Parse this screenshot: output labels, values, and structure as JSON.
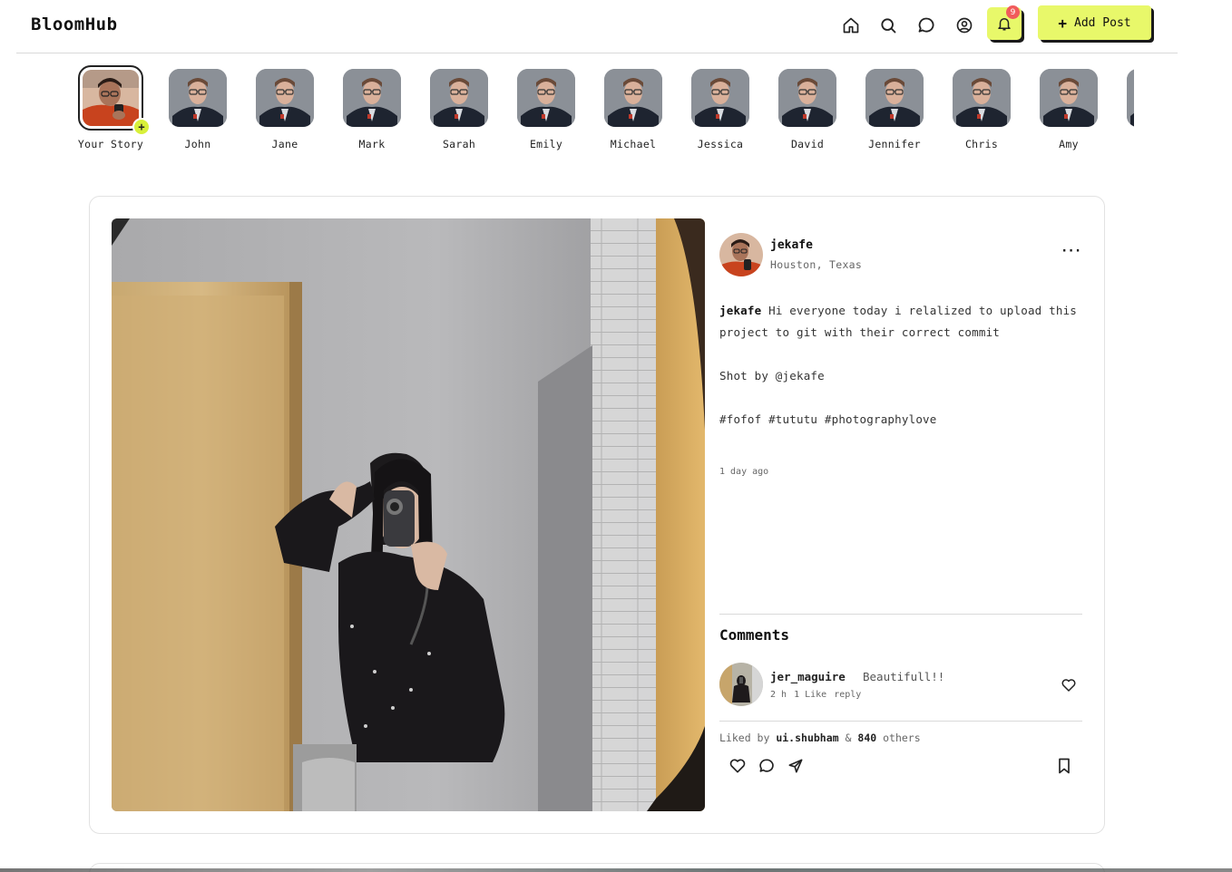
{
  "app": {
    "title": "BloomHub"
  },
  "header": {
    "notification_count": "9",
    "add_post_label": "Add Post",
    "icons": [
      "home-icon",
      "search-icon",
      "chat-icon",
      "profile-icon",
      "bell-icon"
    ]
  },
  "stories": {
    "your_story_label": "Your Story",
    "items": [
      {
        "name": "John"
      },
      {
        "name": "Jane"
      },
      {
        "name": "Mark"
      },
      {
        "name": "Sarah"
      },
      {
        "name": "Emily"
      },
      {
        "name": "Michael"
      },
      {
        "name": "Jessica"
      },
      {
        "name": "David"
      },
      {
        "name": "Jennifer"
      },
      {
        "name": "Chris"
      },
      {
        "name": "Amy"
      }
    ]
  },
  "post": {
    "author": "jekafe",
    "location": "Houston, Texas",
    "caption_user": "jekafe",
    "caption_text": "Hi everyone today i relalized to upload this project to git with their correct commit",
    "caption_credit": "Shot by @jekafe",
    "caption_tags": "#fofof #tututu #photographylove",
    "time_ago": "1 day ago",
    "comments_title": "Comments",
    "comment": {
      "user": "jer_maguire",
      "text": "Beautifull!!",
      "time": "2 h",
      "likes": "1 Like",
      "reply": "reply"
    },
    "liked_by_prefix": "Liked by",
    "liked_by_user": "ui.shubham",
    "liked_by_amp": "&",
    "liked_by_count": "840",
    "liked_by_suffix": "others"
  },
  "colors": {
    "accent": "#e8f86a",
    "badge": "#f15b5b",
    "border": "#e2e2e2"
  }
}
